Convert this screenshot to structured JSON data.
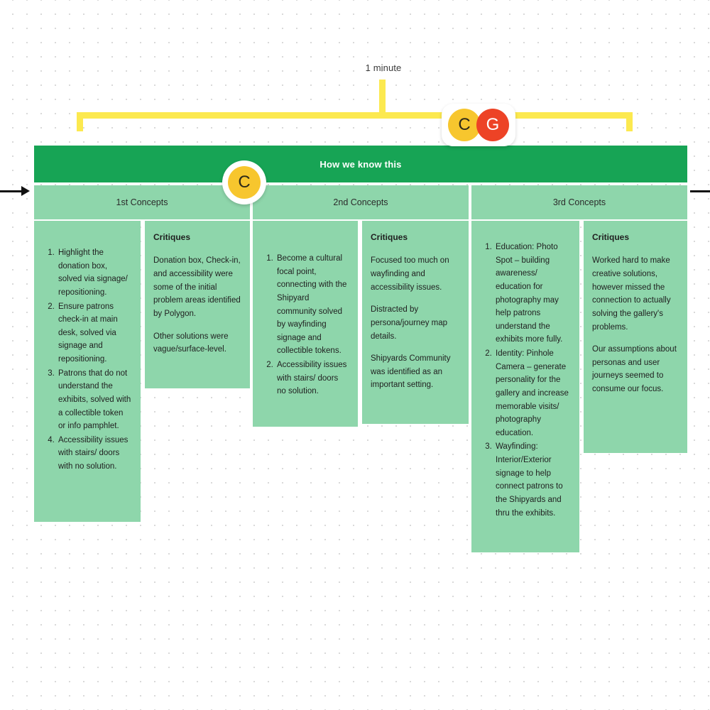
{
  "board": {
    "timing": {
      "label": "1 minute"
    },
    "header_title": "How we know this",
    "columns": [
      {
        "label": "1st Concepts"
      },
      {
        "label": "2nd Concepts"
      },
      {
        "label": "3rd Concepts"
      }
    ],
    "avatars": {
      "pair": [
        {
          "initial": "C",
          "color": "#f7c62e"
        },
        {
          "initial": "G",
          "color": "#ed4326"
        }
      ],
      "single": {
        "initial": "C",
        "color": "#f7c62e"
      }
    },
    "critiques_title": "Critiques",
    "column1": {
      "concepts": [
        "Highlight the donation box, solved via signage/ repositioning.",
        "Ensure patrons check-in at main desk, solved via signage and repositioning.",
        "Patrons that do not understand the exhibits, solved with a collectible token or info pamphlet.",
        "Accessibility issues with stairs/ doors with no solution."
      ],
      "critiques": [
        "Donation box, Check-in, and accessibility were some of the initial problem areas identified by Polygon.",
        "Other solutions were vague/surface-level."
      ]
    },
    "column2": {
      "concepts": [
        "Become a cultural focal point, connecting with the Shipyard community solved by wayfinding signage and collectible tokens.",
        "Accessibility issues with stairs/ doors no solution."
      ],
      "critiques": [
        "Focused too much on wayfinding and accessibility issues.",
        "Distracted by persona/journey map details.",
        "Shipyards Community was identified as an important setting."
      ]
    },
    "column3": {
      "concepts": [
        "Education: Photo Spot – building awareness/ education for photography may help patrons understand the exhibits more fully.",
        "Identity: Pinhole Camera – generate personality for the gallery and increase memorable visits/ photography education.",
        "Wayfinding: Interior/Exterior signage to help connect patrons to the Shipyards and thru the exhibits."
      ],
      "critiques": [
        "Worked hard to make creative solutions, however missed the connection to actually solving the gallery's problems.",
        "Our assumptions about personas and user journeys seemed to consume our focus."
      ]
    },
    "colors": {
      "header_green": "#17a455",
      "card_green": "#8ed6ab",
      "bracket_yellow": "#fce94f"
    }
  }
}
